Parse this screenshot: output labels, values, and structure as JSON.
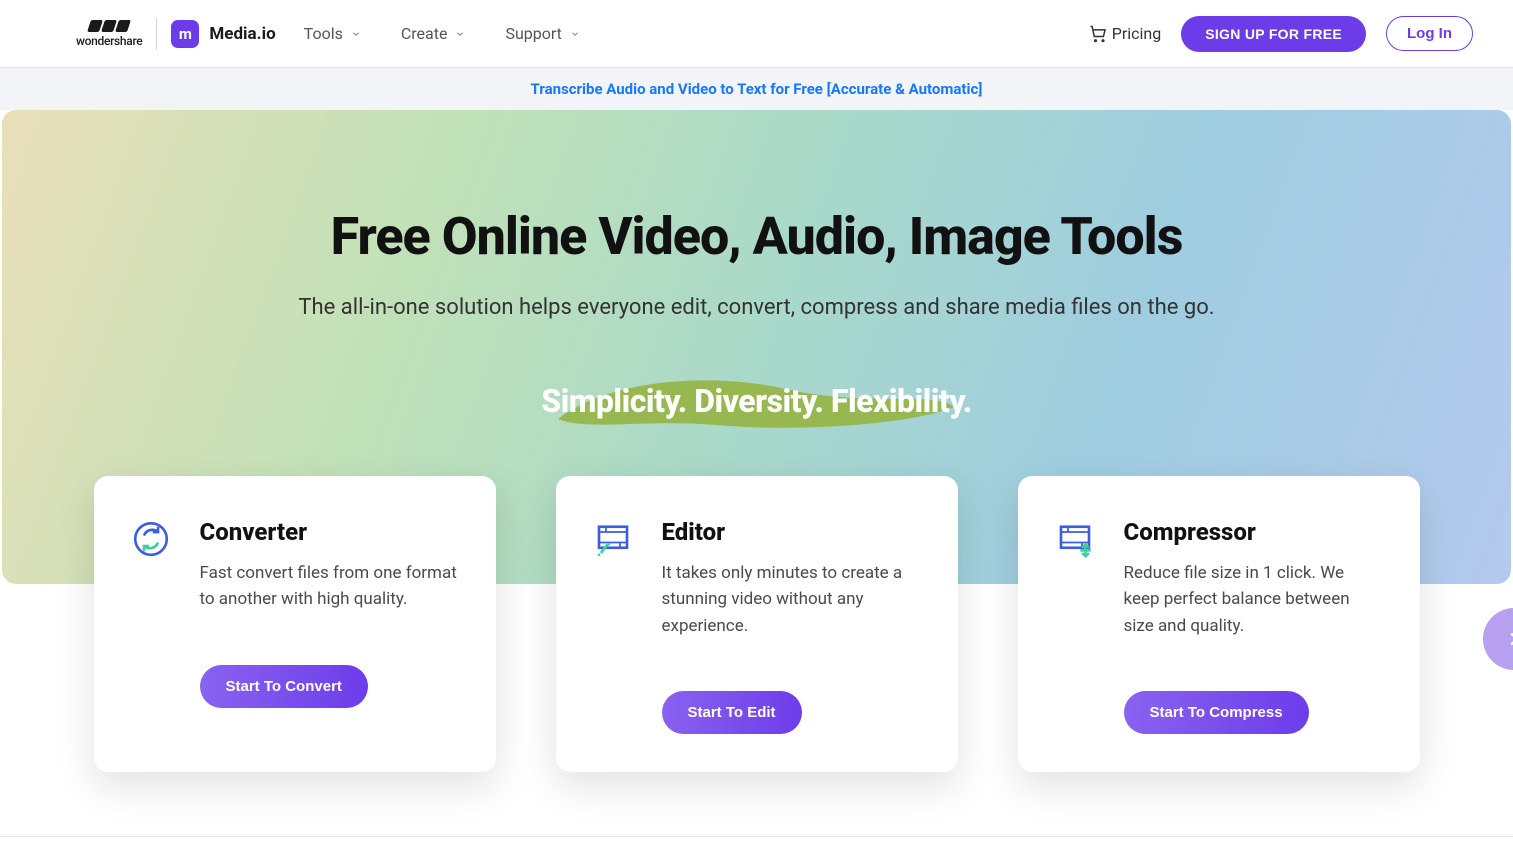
{
  "brand": {
    "parent": "wondershare",
    "product": "Media.io"
  },
  "nav": {
    "tools": "Tools",
    "create": "Create",
    "support": "Support"
  },
  "header": {
    "pricing": "Pricing",
    "signup": "SIGN UP FOR FREE",
    "login": "Log In"
  },
  "banner": {
    "text": "Transcribe Audio and Video to Text for Free [Accurate & Automatic]"
  },
  "hero": {
    "title": "Free Online Video, Audio, Image Tools",
    "subtitle": "The all-in-one solution helps everyone edit, convert, compress and share media files on the go.",
    "tagline": "Simplicity. Diversity. Flexibility."
  },
  "cards": [
    {
      "title": "Converter",
      "desc": "Fast convert files from one format to another with high quality.",
      "cta": "Start To Convert"
    },
    {
      "title": "Editor",
      "desc": "It takes only minutes to create a stunning video without any experience.",
      "cta": "Start To Edit"
    },
    {
      "title": "Compressor",
      "desc": "Reduce file size in 1 click. We keep perfect balance between size and quality.",
      "cta": "Start To Compress"
    }
  ],
  "colors": {
    "accent": "#6c3ce9",
    "link": "#1678ff"
  }
}
